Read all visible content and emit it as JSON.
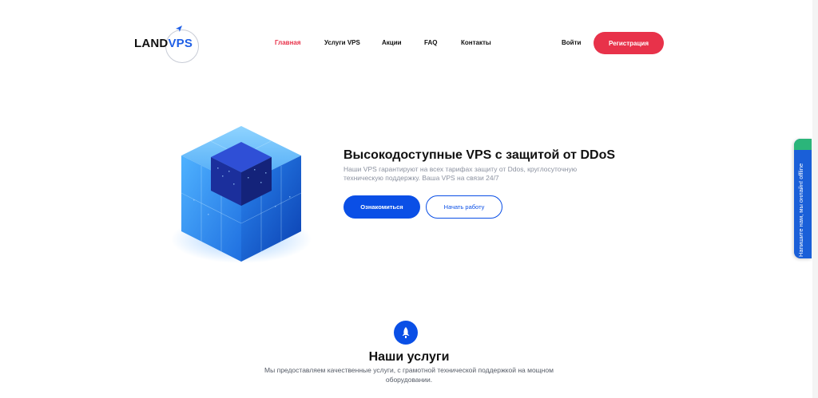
{
  "logo": {
    "word_main": "LAND",
    "word_accent": "VPS"
  },
  "nav": {
    "items": [
      {
        "label": "Главная",
        "active": true
      },
      {
        "label": "Услуги VPS",
        "active": false
      },
      {
        "label": "Акции",
        "active": false
      },
      {
        "label": "FAQ",
        "active": false
      },
      {
        "label": "Контакты",
        "active": false
      }
    ],
    "login_label": "Войти",
    "register_label": "Регистрация"
  },
  "hero": {
    "title": "Высокодоступные VPS с защитой от DDoS",
    "description": "Наши VPS гарантируют на всех тарифах защиту от Ddos, круглосуточную техническую поддержку. Ваша VPS на связи 24/7",
    "primary_button": "Ознакомиться",
    "secondary_button": "Начать работу"
  },
  "services": {
    "title": "Наши услуги",
    "description": "Мы предоставляем качественные услуги, с грамотной технической поддержкой на мощном оборудовании."
  },
  "chat_widget": {
    "label": "Напишите нам, мы онлайн!",
    "status": "offline"
  },
  "colors": {
    "accent_red": "#e8324a",
    "accent_blue": "#0a4fe6"
  }
}
